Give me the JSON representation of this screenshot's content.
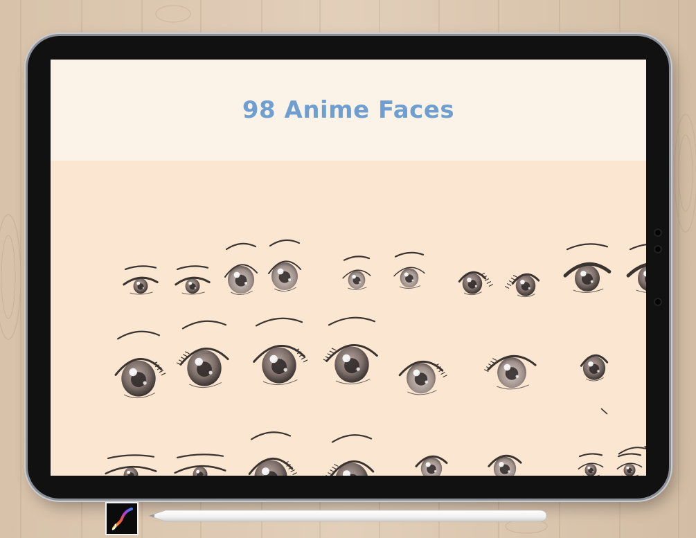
{
  "title": "98 Anime Faces",
  "icons": {
    "app": "procreate-app-icon",
    "stylus": "apple-pencil"
  },
  "colors": {
    "title": "#6f9ed0",
    "banner": "#fcf3e8",
    "canvas": "#fbe7d1",
    "ink": "#3a3330",
    "iris": "#8a7b76"
  }
}
